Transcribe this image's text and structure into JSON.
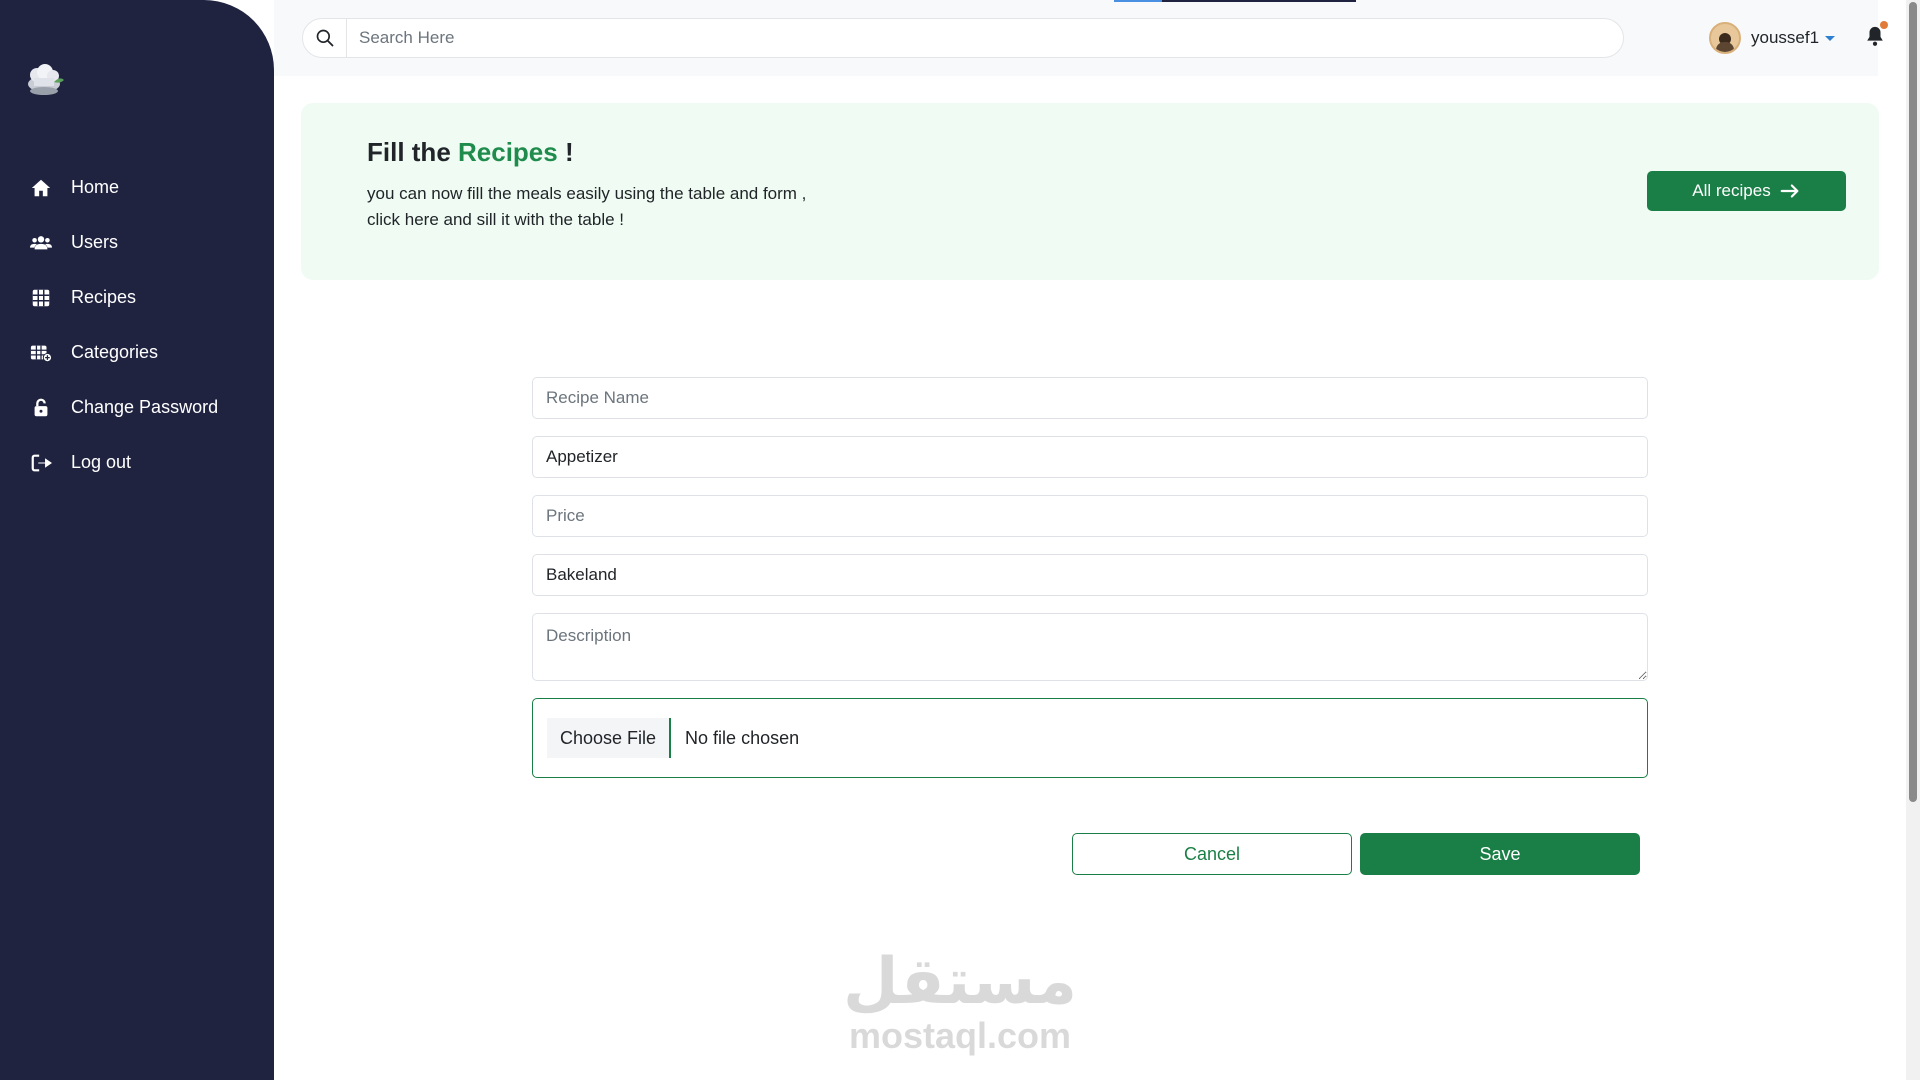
{
  "sidebar": {
    "logo_icon": "chef-hat-icon",
    "items": [
      {
        "label": "Home",
        "icon": "home-icon"
      },
      {
        "label": "Users",
        "icon": "users-icon"
      },
      {
        "label": "Recipes",
        "icon": "table-grid-icon"
      },
      {
        "label": "Categories",
        "icon": "categories-icon"
      },
      {
        "label": "Change Password",
        "icon": "unlock-icon"
      },
      {
        "label": "Log out",
        "icon": "logout-icon"
      }
    ]
  },
  "header": {
    "search_placeholder": "Search Here",
    "username": "youssef1"
  },
  "banner": {
    "title_prefix": "Fill the ",
    "title_accent": "Recipes",
    "title_suffix": " !",
    "subtitle_line1": "you can now fill the meals easily using the table and form ,",
    "subtitle_line2": "click here and sill it with the table !",
    "button_label": "All recipes"
  },
  "form": {
    "recipe_name_placeholder": "Recipe Name",
    "category_value": "Appetizer",
    "price_placeholder": "Price",
    "tag_value": "Bakeland",
    "description_placeholder": "Description",
    "file_button_label": "Choose File",
    "file_status": "No file chosen",
    "cancel_label": "Cancel",
    "save_label": "Save"
  },
  "watermark": {
    "arabic": "مستقل",
    "latin": "mostaql.com"
  },
  "colors": {
    "sidebar_bg": "#1f2340",
    "accent_green": "#1a7f46",
    "banner_bg": "#f0fcf3"
  }
}
